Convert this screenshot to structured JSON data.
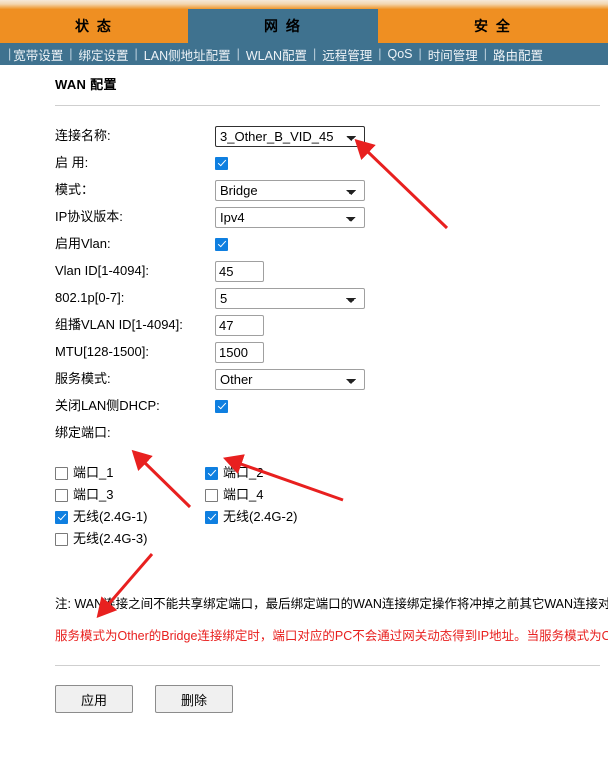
{
  "tabs": [
    {
      "id": "status",
      "label": "状 态",
      "active": false
    },
    {
      "id": "network",
      "label": "网 络",
      "active": true
    },
    {
      "id": "security",
      "label": "安 全",
      "active": false
    }
  ],
  "subnav": {
    "lead": "|",
    "separator": "|",
    "items": [
      {
        "id": "broadband",
        "label": "宽带设置"
      },
      {
        "id": "binding",
        "label": "绑定设置"
      },
      {
        "id": "lan-addr",
        "label": "LAN侧地址配置"
      },
      {
        "id": "wlan",
        "label": "WLAN配置"
      },
      {
        "id": "remote-mgmt",
        "label": "远程管理"
      },
      {
        "id": "qos",
        "label": "QoS"
      },
      {
        "id": "time-mgmt",
        "label": "时间管理"
      },
      {
        "id": "route",
        "label": "路由配置"
      }
    ]
  },
  "page": {
    "title": "WAN 配置"
  },
  "form": {
    "connection_name": {
      "label": "连接名称:",
      "value": "3_Other_B_VID_45",
      "options": [
        "3_Other_B_VID_45"
      ]
    },
    "enable": {
      "label": "启 用:",
      "checked": true
    },
    "mode": {
      "label": "模式：",
      "value": "Bridge",
      "options": [
        "Bridge"
      ]
    },
    "ip_version": {
      "label": "IP协议版本:",
      "value": "Ipv4",
      "options": [
        "Ipv4"
      ]
    },
    "enable_vlan": {
      "label": "启用Vlan:",
      "checked": true
    },
    "vlan_id": {
      "label": "Vlan ID[1-4094]:",
      "value": "45"
    },
    "p8021p": {
      "label": "802.1p[0-7]:",
      "value": "5",
      "options": [
        "5"
      ]
    },
    "multicast_vlan_id": {
      "label": "组播VLAN ID[1-4094]:",
      "value": "47"
    },
    "mtu": {
      "label": "MTU[128-1500]:",
      "value": "1500"
    },
    "service_mode": {
      "label": "服务模式:",
      "value": "Other",
      "options": [
        "Other"
      ]
    },
    "disable_lan_dhcp": {
      "label": "关闭LAN侧DHCP:",
      "checked": true
    },
    "bind_ports": {
      "label": "绑定端口:",
      "items": [
        {
          "id": "port1",
          "label": "端口_1",
          "checked": false
        },
        {
          "id": "port2",
          "label": "端口_2",
          "checked": true
        },
        {
          "id": "port3",
          "label": "端口_3",
          "checked": false
        },
        {
          "id": "port4",
          "label": "端口_4",
          "checked": false
        },
        {
          "id": "wlan24g1",
          "label": "无线(2.4G-1)",
          "checked": true
        },
        {
          "id": "wlan24g2",
          "label": "无线(2.4G-2)",
          "checked": true
        },
        {
          "id": "wlan24g3",
          "label": "无线(2.4G-3)",
          "checked": false
        }
      ]
    }
  },
  "notes": {
    "note_text": "注: WAN连接之间不能共享绑定端口，最后绑定端口的WAN连接绑定操作将冲掉之前其它WAN连接对该",
    "warning_text": "服务模式为Other的Bridge连接绑定时，端口对应的PC不会通过网关动态得到IP地址。当服务模式为Oth"
  },
  "buttons": {
    "apply": "应用",
    "delete": "删除"
  },
  "colors": {
    "tab_active_bg": "#3f728f",
    "tab_inactive_bg": "#ef8f22",
    "subnav_bg": "#3f728f",
    "warning_text": "#e8201f",
    "annotation_arrow": "#e8201f",
    "checkbox_checked": "#0f7fe0"
  }
}
